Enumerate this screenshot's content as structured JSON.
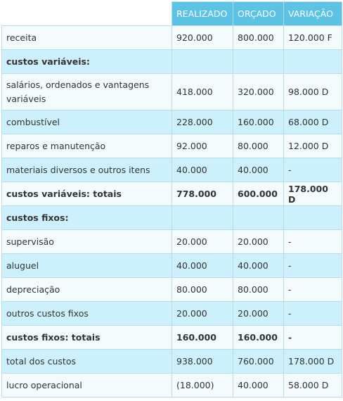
{
  "header": {
    "col1": "",
    "col2": "REALIZADO",
    "col3": "ORÇADO",
    "col4": "VARIAÇÃO"
  },
  "rows": [
    {
      "label": "receita",
      "realizado": "920.000",
      "orcado": "800.000",
      "variacao": "120.000 F"
    },
    {
      "label": "custos variáveis:",
      "realizado": "",
      "orcado": "",
      "variacao": ""
    },
    {
      "label": "salários, ordenados e vantagens variáveis",
      "realizado": "418.000",
      "orcado": "320.000",
      "variacao": "98.000 D"
    },
    {
      "label": "combustível",
      "realizado": "228.000",
      "orcado": "160.000",
      "variacao": "68.000 D"
    },
    {
      "label": "reparos e manutenção",
      "realizado": "92.000",
      "orcado": "80.000",
      "variacao": "12.000 D"
    },
    {
      "label": "materiais diversos e outros itens",
      "realizado": "40.000",
      "orcado": "40.000",
      "variacao": "-"
    },
    {
      "label": "custos variáveis: totais",
      "realizado": "778.000",
      "orcado": "600.000",
      "variacao": "178.000 D"
    },
    {
      "label": "custos fixos:",
      "realizado": "",
      "orcado": "",
      "variacao": ""
    },
    {
      "label": "supervisão",
      "realizado": "20.000",
      "orcado": "20.000",
      "variacao": "-"
    },
    {
      "label": "aluguel",
      "realizado": "40.000",
      "orcado": "40.000",
      "variacao": "-"
    },
    {
      "label": "depreciação",
      "realizado": "80.000",
      "orcado": "80.000",
      "variacao": "-"
    },
    {
      "label": "outros custos fixos",
      "realizado": "20.000",
      "orcado": "20.000",
      "variacao": "-"
    },
    {
      "label": "custos fixos: totais",
      "realizado": "160.000",
      "orcado": "160.000",
      "variacao": "-"
    },
    {
      "label": "total dos custos",
      "realizado": "938.000",
      "orcado": "760.000",
      "variacao": "178.000 D"
    },
    {
      "label": "lucro operacional",
      "realizado": "(18.000)",
      "orcado": "40.000",
      "variacao": "58.000 D"
    }
  ],
  "colors": {
    "header_bg": "#5cc3e5",
    "row_light": "#f3fbfd",
    "row_blue": "#cdf0fd",
    "border": "#b9dde8"
  }
}
